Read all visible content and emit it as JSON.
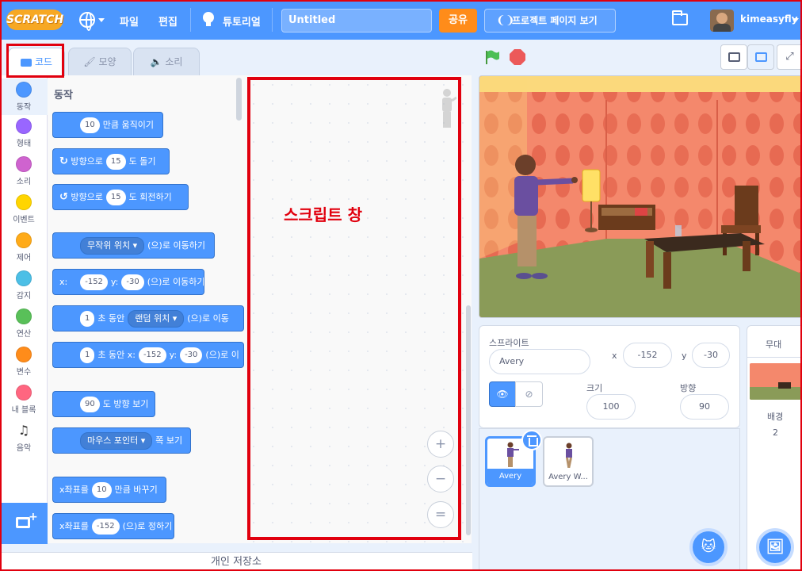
{
  "menubar": {
    "logo": "SCRATCH",
    "file": "파일",
    "edit": "편집",
    "tutorials": "튜토리얼",
    "project_title": "Untitled",
    "share": "공유",
    "project_page": "프로젝트 페이지 보기",
    "username": "kimeasyfly"
  },
  "tabs": {
    "code": "코드",
    "costumes": "모양",
    "sounds": "소리"
  },
  "categories": [
    {
      "label": "동작",
      "color": "#4c97ff"
    },
    {
      "label": "형태",
      "color": "#9966ff"
    },
    {
      "label": "소리",
      "color": "#cf63cf"
    },
    {
      "label": "이벤트",
      "color": "#ffd500"
    },
    {
      "label": "제어",
      "color": "#ffab19"
    },
    {
      "label": "감지",
      "color": "#4cbfe6"
    },
    {
      "label": "연산",
      "color": "#59c059"
    },
    {
      "label": "변수",
      "color": "#ff8c1a"
    },
    {
      "label": "내 블록",
      "color": "#ff6680"
    },
    {
      "label": "음악",
      "color": ""
    }
  ],
  "palette": {
    "heading": "동작",
    "move": {
      "value": "10",
      "text": "만큼 움직이기"
    },
    "turn_right": {
      "pre": "방향으로",
      "value": "15",
      "post": "도 돌기"
    },
    "turn_left": {
      "pre": "방향으로",
      "value": "15",
      "post": "도 회전하기"
    },
    "goto": {
      "dropdown": "무작위 위치",
      "post": "(으)로 이동하기"
    },
    "goto_xy": {
      "x_label": "x:",
      "x": "-152",
      "y_label": "y:",
      "y": "-30",
      "post": "(으)로 이동하기"
    },
    "glide_to": {
      "secs": "1",
      "mid": "초 동안",
      "dropdown": "랜덤 위치",
      "post": "(으)로 이동"
    },
    "glide_xy": {
      "secs": "1",
      "mid": "초 동안 x:",
      "x": "-152",
      "y_label": "y:",
      "y": "-30",
      "post": "(으)로 이"
    },
    "point_dir": {
      "value": "90",
      "post": "도 방향 보기"
    },
    "point_towards": {
      "dropdown": "마우스 포인터",
      "post": "쪽 보기"
    },
    "change_x": {
      "pre": "x좌표를",
      "value": "10",
      "post": "만큼 바꾸기"
    },
    "set_x": {
      "pre": "x좌표를",
      "value": "-152",
      "post": "(으)로 정하기"
    }
  },
  "script_area": {
    "annotation": "스크립트 창",
    "zoom_in": "+",
    "zoom_out": "−",
    "zoom_reset": "="
  },
  "backpack": "개인 저장소",
  "sprite_info": {
    "sprite_label": "스프라이트",
    "sprite_name": "Avery",
    "x_label": "x",
    "x": "-152",
    "y_label": "y",
    "y": "-30",
    "size_label": "크기",
    "size": "100",
    "direction_label": "방향",
    "direction": "90"
  },
  "sprites": [
    {
      "name": "Avery",
      "selected": true
    },
    {
      "name": "Avery W...",
      "selected": false
    }
  ],
  "stage_pane": {
    "title": "무대",
    "backdrops_label": "배경",
    "backdrops_count": "2"
  },
  "colors": {
    "primary": "#4c97ff",
    "annotation_red": "#e1000e",
    "share_orange": "#ff8c1a"
  }
}
